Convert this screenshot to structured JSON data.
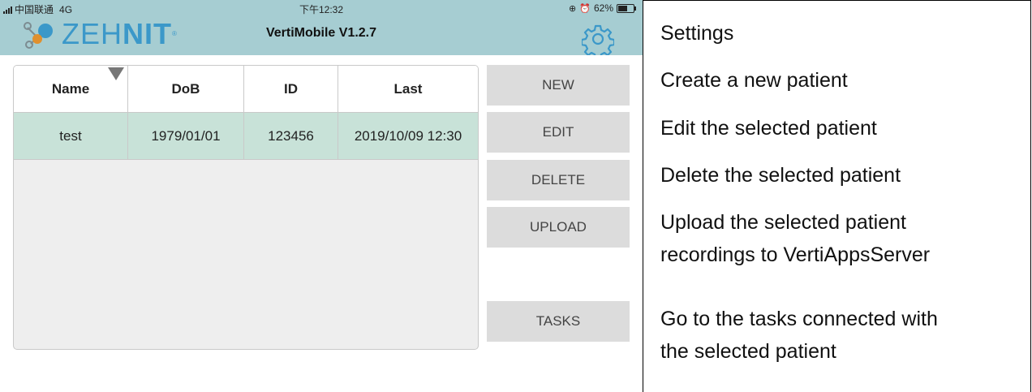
{
  "status_bar": {
    "carrier": "中国联通",
    "network": "4G",
    "time": "下午12:32",
    "battery": "62%",
    "battery_level": 0.62
  },
  "header": {
    "logo_text_a": "ZEH",
    "logo_text_b": "NIT",
    "app_title": "VertiMobile V1.2.7",
    "background": "#a6cdd2",
    "logo_color": "#3b98c9",
    "settings_icon": "gear-icon"
  },
  "table": {
    "columns": [
      "Name",
      "DoB",
      "ID",
      "Last"
    ],
    "sort_icon": "sort-down-icon",
    "rows": [
      {
        "name": "test",
        "dob": "1979/01/01",
        "id": "123456",
        "last": "2019/10/09 12:30"
      }
    ],
    "selected_color": "#c8e2d8"
  },
  "buttons": {
    "new": "NEW",
    "edit": "EDIT",
    "delete": "DELETE",
    "upload": "UPLOAD",
    "tasks": "TASKS"
  },
  "descriptions": {
    "settings": "Settings",
    "new": "Create a new patient",
    "edit": "Edit the selected patient",
    "delete": "Delete the selected patient",
    "upload_line1": "Upload the selected patient",
    "upload_line2": "recordings to VertiAppsServer",
    "tasks_line1": "Go to the tasks connected with",
    "tasks_line2": "the selected patient"
  }
}
